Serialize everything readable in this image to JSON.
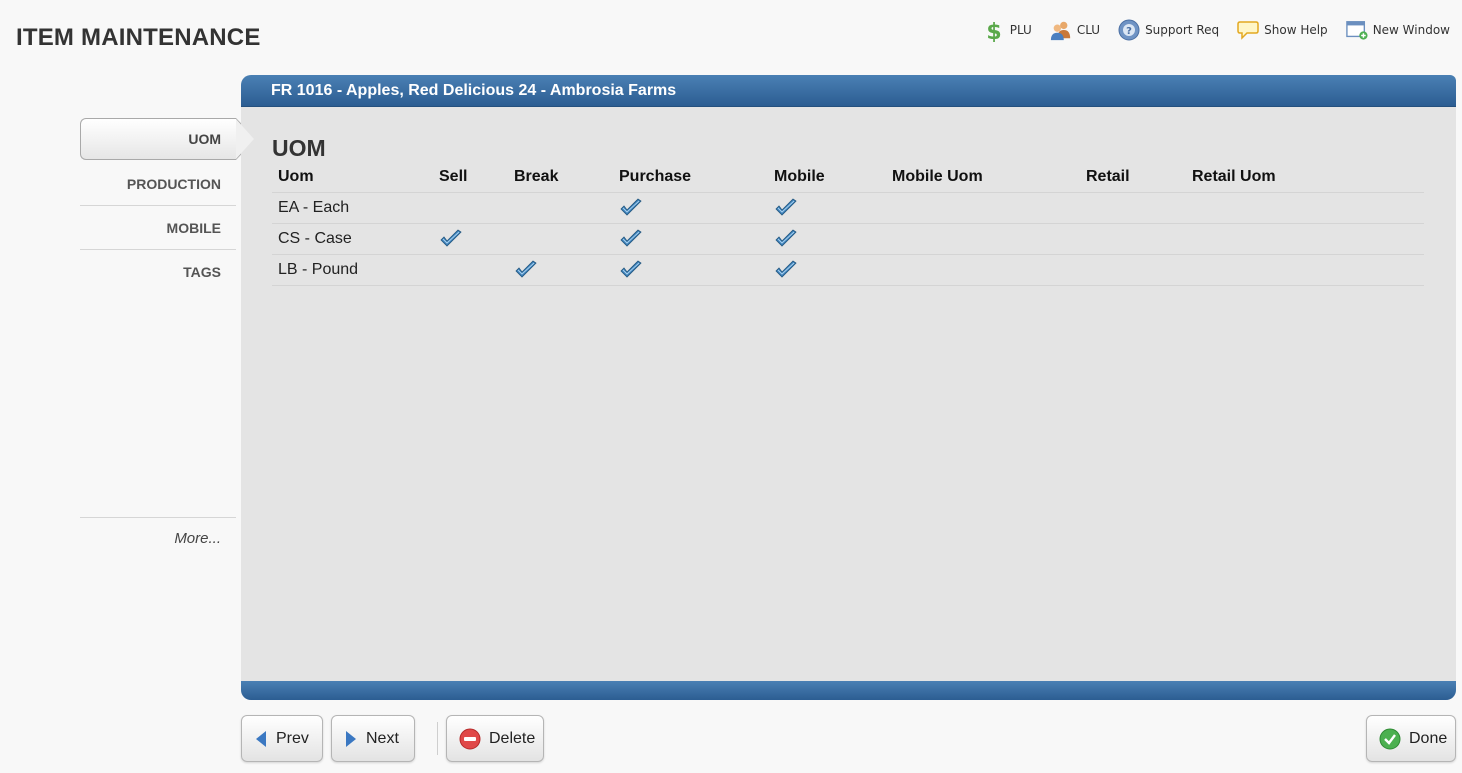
{
  "page_title": "ITEM MAINTENANCE",
  "top_actions": [
    {
      "label": "PLU",
      "icon": "dollar-icon"
    },
    {
      "label": "CLU",
      "icon": "users-icon"
    },
    {
      "label": "Support Req",
      "icon": "help-circle-icon"
    },
    {
      "label": "Show Help",
      "icon": "speech-bubble-icon"
    },
    {
      "label": "New Window",
      "icon": "new-window-icon"
    }
  ],
  "side_nav": {
    "items": [
      {
        "label": "UOM",
        "active": true
      },
      {
        "label": "PRODUCTION",
        "active": false
      },
      {
        "label": "MOBILE",
        "active": false
      },
      {
        "label": "TAGS",
        "active": false
      }
    ],
    "more_label": "More..."
  },
  "panel": {
    "header_title": "FR 1016 - Apples, Red Delicious 24 - Ambrosia Farms",
    "section_title": "UOM",
    "table": {
      "columns": [
        "Uom",
        "Sell",
        "Break",
        "Purchase",
        "Mobile",
        "Mobile Uom",
        "Retail",
        "Retail Uom"
      ],
      "rows": [
        {
          "uom": "EA - Each",
          "sell": false,
          "break": false,
          "purchase": true,
          "mobile": true,
          "mobile_uom": "",
          "retail": "",
          "retail_uom": ""
        },
        {
          "uom": "CS - Case",
          "sell": true,
          "break": false,
          "purchase": true,
          "mobile": true,
          "mobile_uom": "",
          "retail": "",
          "retail_uom": ""
        },
        {
          "uom": "LB - Pound",
          "sell": false,
          "break": true,
          "purchase": true,
          "mobile": true,
          "mobile_uom": "",
          "retail": "",
          "retail_uom": ""
        }
      ]
    }
  },
  "buttons": {
    "prev": "Prev",
    "next": "Next",
    "delete": "Delete",
    "done": "Done"
  },
  "colors": {
    "header_blue": "#2c5d92",
    "check_blue": "#3a7fb8"
  }
}
